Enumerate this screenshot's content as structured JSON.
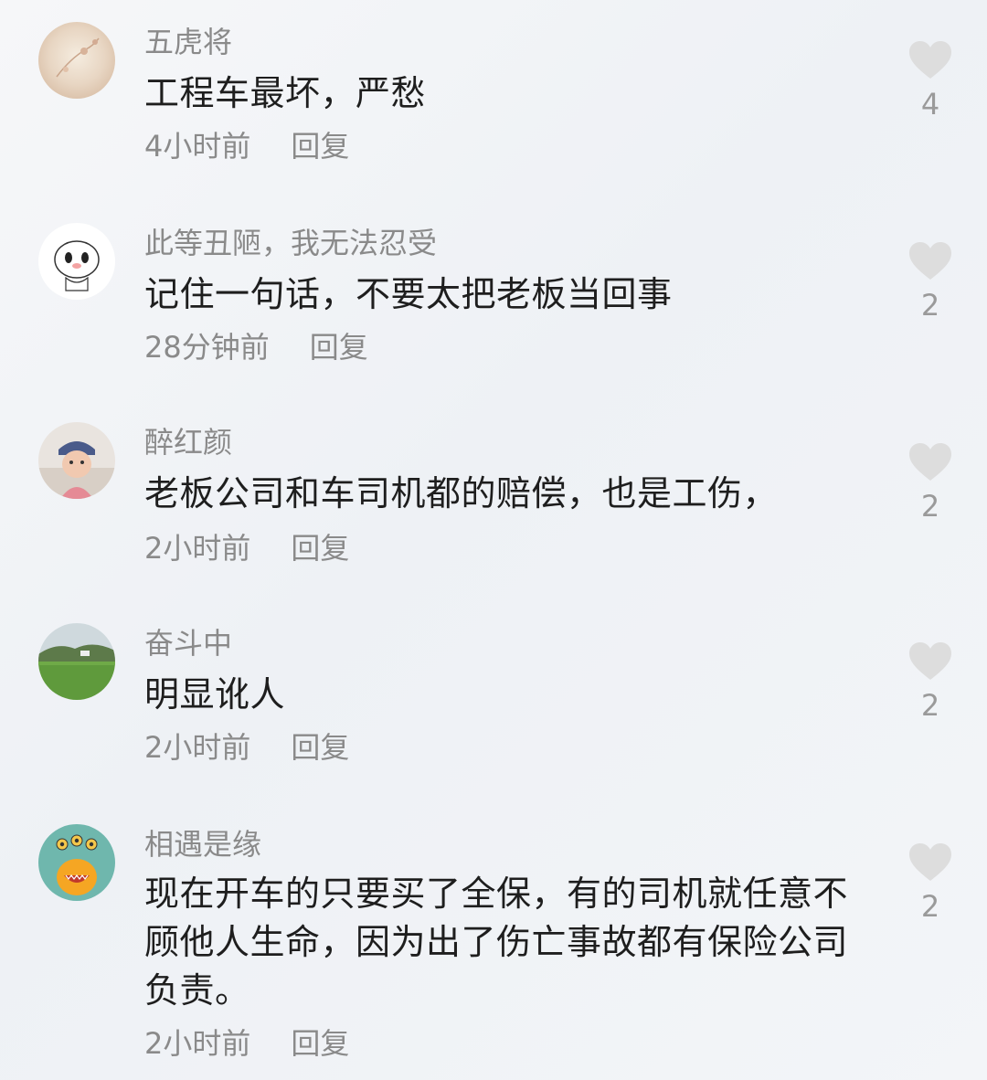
{
  "comments": [
    {
      "username": "五虎将",
      "avatar_icon": "floral-photo-avatar",
      "text": "工程车最坏，严愁",
      "time": "4小时前",
      "reply_label": "回复",
      "like_icon": "heart-icon",
      "likes": "4"
    },
    {
      "username": "此等丑陋，我无法忍受",
      "avatar_icon": "cartoon-bun-avatar",
      "text": "记住一句话，不要太把老板当回事",
      "time": "28分钟前",
      "reply_label": "回复",
      "like_icon": "heart-icon",
      "likes": "2"
    },
    {
      "username": "醉红颜",
      "avatar_icon": "child-photo-avatar",
      "text": "老板公司和车司机都的赔偿，也是工伤，",
      "time": "2小时前",
      "reply_label": "回复",
      "like_icon": "heart-icon",
      "likes": "2"
    },
    {
      "username": "奋斗中",
      "avatar_icon": "landscape-photo-avatar",
      "text": "明显讹人",
      "time": "2小时前",
      "reply_label": "回复",
      "like_icon": "heart-icon",
      "likes": "2"
    },
    {
      "username": "相遇是缘",
      "avatar_icon": "alien-monster-avatar",
      "text": "现在开车的只要买了全保，有的司机就任意不顾他人生命，因为出了伤亡事故都有保险公司负责。",
      "time": "2小时前",
      "reply_label": "回复",
      "like_icon": "heart-icon",
      "likes": "2"
    }
  ],
  "colors": {
    "username": "#8a8a8a",
    "text": "#1e1e1e",
    "meta": "#8a8a8a",
    "heart": "#dddddd",
    "alien_avatar_bg": "#6fb7ad"
  }
}
